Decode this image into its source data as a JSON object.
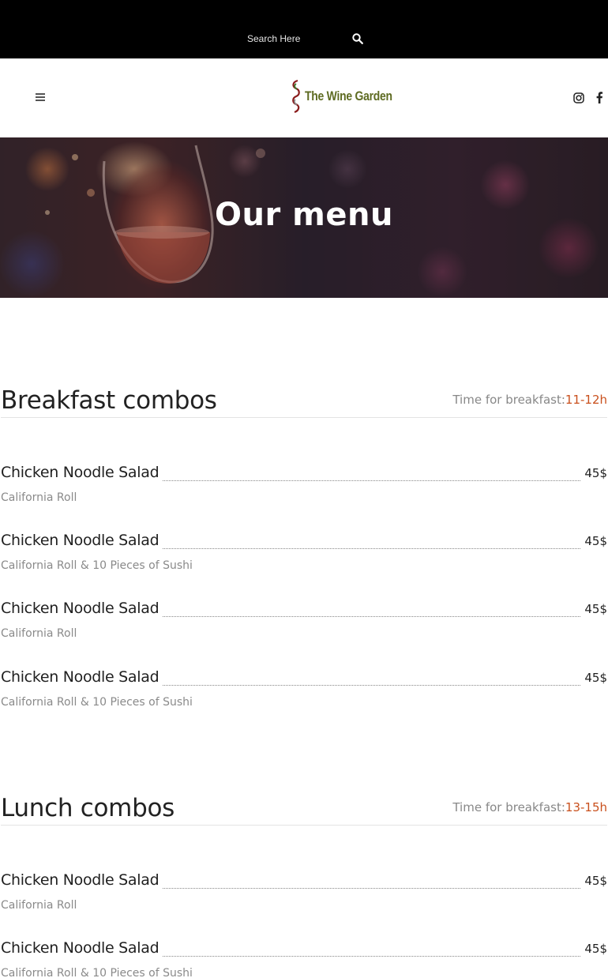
{
  "search": {
    "placeholder": "Search Here",
    "value": ""
  },
  "header": {
    "brand": "The Wine Garden",
    "brand_color": "#5e6b22",
    "icons": {
      "menu": "hamburger-icon",
      "search": "search-icon",
      "instagram": "instagram-icon",
      "facebook": "facebook-icon"
    }
  },
  "hero": {
    "title": "Our menu"
  },
  "accent_color": "#c9501d",
  "sections": [
    {
      "title": "Breakfast combos",
      "time_label": "Time for breakfast:",
      "time_value": "11-12h",
      "items": [
        {
          "name": "Chicken Noodle Salad",
          "desc": "California Roll",
          "price": "45$"
        },
        {
          "name": "Chicken Noodle Salad",
          "desc": "California Roll & 10 Pieces of Sushi",
          "price": "45$"
        },
        {
          "name": "Chicken Noodle Salad",
          "desc": "California Roll",
          "price": "45$"
        },
        {
          "name": "Chicken Noodle Salad",
          "desc": "California Roll & 10 Pieces of Sushi",
          "price": "45$"
        }
      ]
    },
    {
      "title": "Lunch combos",
      "time_label": "Time for breakfast:",
      "time_value": "13-15h",
      "items": [
        {
          "name": "Chicken Noodle Salad",
          "desc": "California Roll",
          "price": "45$"
        },
        {
          "name": "Chicken Noodle Salad",
          "desc": "California Roll & 10 Pieces of Sushi",
          "price": "45$"
        }
      ]
    }
  ]
}
